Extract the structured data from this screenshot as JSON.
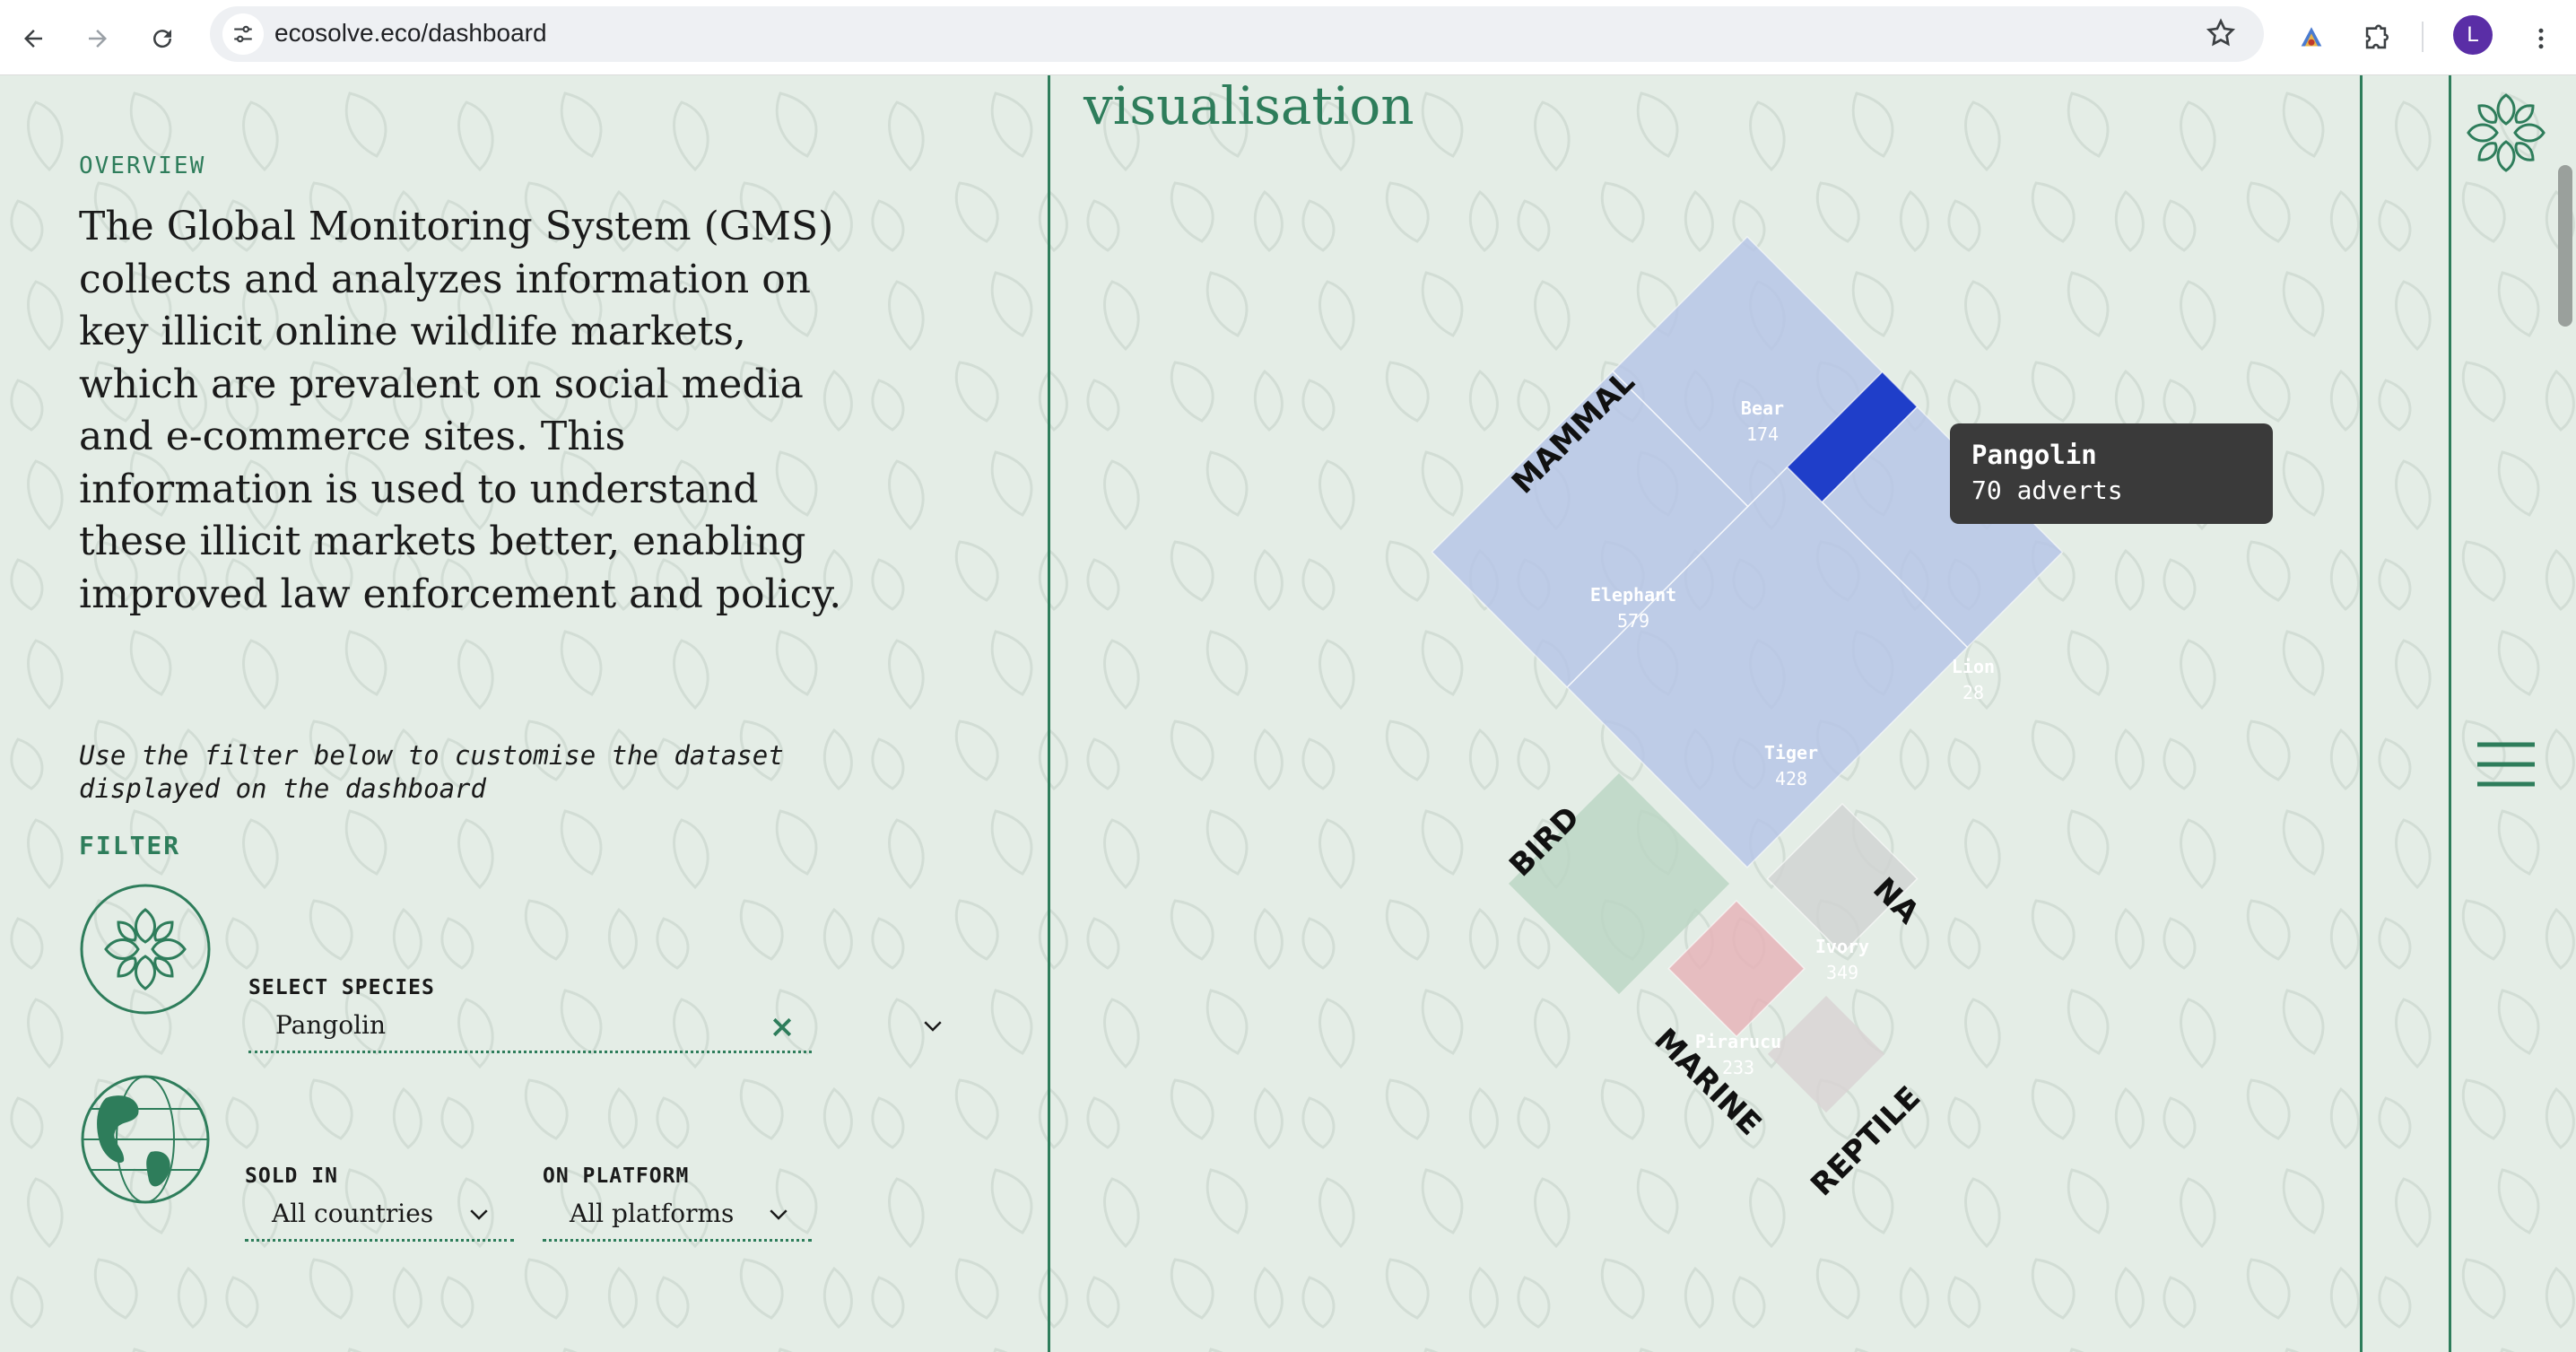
{
  "browser": {
    "url": "ecosolve.eco/dashboard",
    "avatar_letter": "L"
  },
  "overview": {
    "eyebrow": "OVERVIEW",
    "text": "The Global Monitoring System (GMS) collects and analyzes information on key illicit online wildlife markets, which are prevalent on social media and e-commerce sites. This information is used to understand these illicit markets better, enabling improved law enforcement and policy."
  },
  "filter": {
    "hint": "Use the filter below to customise the dataset displayed on the dashboard",
    "label": "FILTER",
    "species": {
      "label": "SELECT SPECIES",
      "value": "Pangolin"
    },
    "sold_in": {
      "label": "SOLD IN",
      "value": "All countries"
    },
    "platform": {
      "label": "ON PLATFORM",
      "value": "All platforms"
    }
  },
  "visualisation": {
    "title": "visualisation",
    "tooltip": {
      "name": "Pangolin",
      "value": "70 adverts"
    }
  },
  "chart_data": {
    "type": "treemap",
    "groups": [
      {
        "name": "MAMMAL",
        "items": [
          {
            "label": "Bear",
            "value": 174
          },
          {
            "label": "Pangolin",
            "value": 70,
            "highlighted": true
          },
          {
            "label": "Elephant",
            "value": 579
          },
          {
            "label": "Lion",
            "value": 28
          },
          {
            "label": "Tiger",
            "value": 428
          }
        ]
      },
      {
        "name": "BIRD",
        "items": []
      },
      {
        "name": "NA",
        "items": [
          {
            "label": "Ivory",
            "value": 349
          }
        ]
      },
      {
        "name": "MARINE",
        "items": [
          {
            "label": "Pirarucu",
            "value": 233
          }
        ]
      },
      {
        "name": "REPTILE",
        "items": []
      }
    ],
    "colors": {
      "mammal": "#b7c5e6",
      "highlight": "#1f3ec9",
      "bird": "#bcd6c4",
      "na": "#d1d4d2",
      "marine": "#e6b4b8",
      "reptile": "#d9d4d4"
    }
  }
}
